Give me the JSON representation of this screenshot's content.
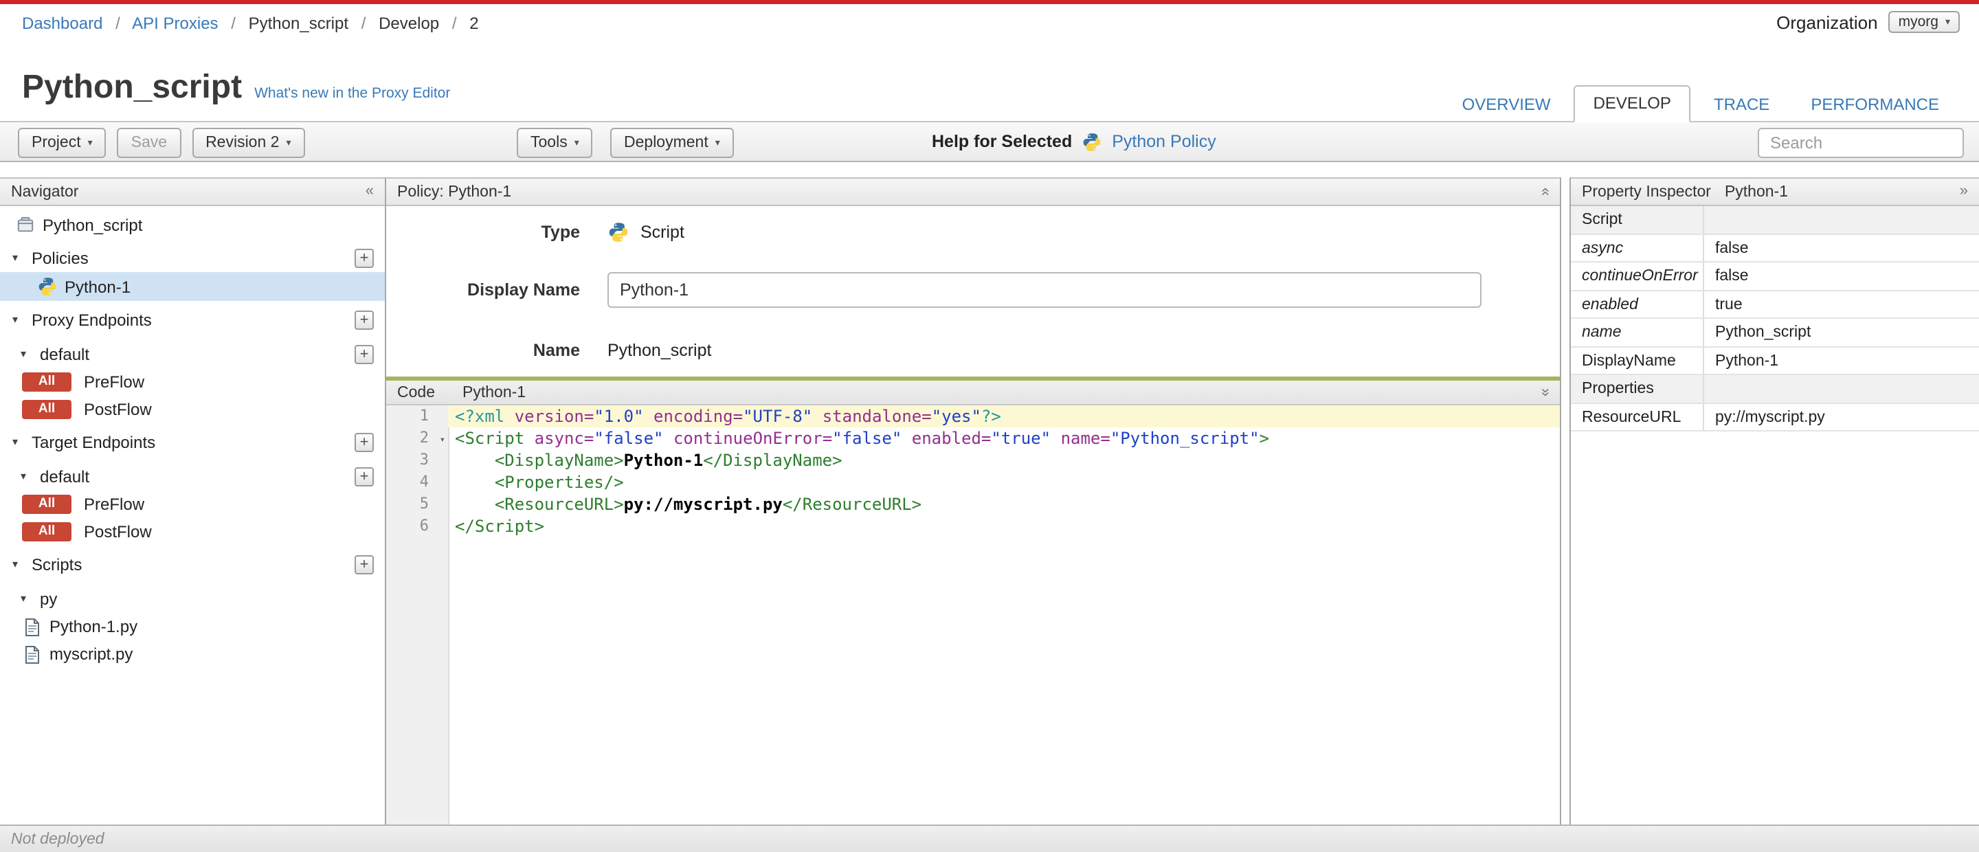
{
  "page": {
    "breadcrumb": {
      "separator": "/",
      "items": [
        {
          "label": "Dashboard",
          "link": true
        },
        {
          "label": "API Proxies",
          "link": true
        },
        {
          "label": "Python_script",
          "link": false
        },
        {
          "label": "Develop",
          "link": false
        },
        {
          "label": "2",
          "link": false
        }
      ]
    },
    "organization": {
      "label": "Organization",
      "value": "myorg"
    },
    "title": "Python_script",
    "whats_new": "What's new in the Proxy Editor",
    "tabs": [
      {
        "label": "OVERVIEW",
        "active": false
      },
      {
        "label": "DEVELOP",
        "active": true
      },
      {
        "label": "TRACE",
        "active": false
      },
      {
        "label": "PERFORMANCE",
        "active": false
      }
    ]
  },
  "toolbar": {
    "project": "Project",
    "save": "Save",
    "revision": "Revision 2",
    "tools": "Tools",
    "deployment": "Deployment",
    "help_for_selected": "Help for Selected",
    "help_link": "Python Policy",
    "search_placeholder": "Search"
  },
  "navigator": {
    "title": "Navigator",
    "collapse_icon": "«",
    "items": [
      {
        "type": "root",
        "label": "Python_script",
        "icon": "proxy-icon"
      },
      {
        "type": "section",
        "label": "Policies",
        "expanded": true,
        "plus": true
      },
      {
        "type": "policy",
        "label": "Python-1",
        "selected": true,
        "icon": "python-icon"
      },
      {
        "type": "section",
        "label": "Proxy Endpoints",
        "expanded": true,
        "plus": true
      },
      {
        "type": "subsection",
        "label": "default",
        "expanded": true,
        "plus": true
      },
      {
        "type": "flow",
        "badge": "All",
        "label": "PreFlow"
      },
      {
        "type": "flow",
        "badge": "All",
        "label": "PostFlow"
      },
      {
        "type": "section",
        "label": "Target Endpoints",
        "expanded": true,
        "plus": true
      },
      {
        "type": "subsection",
        "label": "default",
        "expanded": true,
        "plus": true
      },
      {
        "type": "flow",
        "badge": "All",
        "label": "PreFlow"
      },
      {
        "type": "flow",
        "badge": "All",
        "label": "PostFlow"
      },
      {
        "type": "section",
        "label": "Scripts",
        "expanded": true,
        "plus": true
      },
      {
        "type": "subsection",
        "label": "py",
        "expanded": true
      },
      {
        "type": "file",
        "label": "Python-1.py",
        "icon": "file-icon"
      },
      {
        "type": "file",
        "label": "myscript.py",
        "icon": "file-icon"
      }
    ]
  },
  "policy_panel": {
    "title": "Policy: Python-1",
    "type_label": "Type",
    "type_value": "Script",
    "type_icon": "python-icon",
    "display_name_label": "Display Name",
    "display_name_value": "Python-1",
    "name_label": "Name",
    "name_value": "Python_script"
  },
  "code": {
    "panel_label": "Code",
    "file_label": "Python-1",
    "lines": [
      {
        "n": 1,
        "highlight": true,
        "tokens": [
          [
            "meta",
            "<?xml"
          ],
          [
            "plain",
            " "
          ],
          [
            "attr",
            "version="
          ],
          [
            "str",
            "\"1.0\""
          ],
          [
            "plain",
            " "
          ],
          [
            "attr",
            "encoding="
          ],
          [
            "str",
            "\"UTF-8\""
          ],
          [
            "plain",
            " "
          ],
          [
            "attr",
            "standalone="
          ],
          [
            "str",
            "\"yes\""
          ],
          [
            "meta",
            "?>"
          ]
        ]
      },
      {
        "n": 2,
        "fold": true,
        "tokens": [
          [
            "tag",
            "<Script"
          ],
          [
            "plain",
            " "
          ],
          [
            "attr",
            "async="
          ],
          [
            "str",
            "\"false\""
          ],
          [
            "plain",
            " "
          ],
          [
            "attr",
            "continueOnError="
          ],
          [
            "str",
            "\"false\""
          ],
          [
            "plain",
            " "
          ],
          [
            "attr",
            "enabled="
          ],
          [
            "str",
            "\"true\""
          ],
          [
            "plain",
            " "
          ],
          [
            "attr",
            "name="
          ],
          [
            "str",
            "\"Python_script\""
          ],
          [
            "tag",
            ">"
          ]
        ]
      },
      {
        "n": 3,
        "tokens": [
          [
            "plain",
            "    "
          ],
          [
            "tag",
            "<DisplayName>"
          ],
          [
            "txt",
            "Python-1"
          ],
          [
            "tag",
            "</DisplayName>"
          ]
        ]
      },
      {
        "n": 4,
        "tokens": [
          [
            "plain",
            "    "
          ],
          [
            "tag",
            "<Properties/>"
          ]
        ]
      },
      {
        "n": 5,
        "tokens": [
          [
            "plain",
            "    "
          ],
          [
            "tag",
            "<ResourceURL>"
          ],
          [
            "txt",
            "py://myscript.py"
          ],
          [
            "tag",
            "</ResourceURL>"
          ]
        ]
      },
      {
        "n": 6,
        "tokens": [
          [
            "tag",
            "</Script>"
          ]
        ]
      }
    ]
  },
  "inspector": {
    "title": "Property Inspector",
    "subtitle": "Python-1",
    "expand_icon": "»",
    "rows": [
      {
        "name": "Script",
        "value": "",
        "section": true
      },
      {
        "name": "async",
        "value": "false",
        "italic": true
      },
      {
        "name": "continueOnError",
        "value": "false",
        "italic": true
      },
      {
        "name": "enabled",
        "value": "true",
        "italic": true
      },
      {
        "name": "name",
        "value": "Python_script",
        "italic": true
      },
      {
        "name": "DisplayName",
        "value": "Python-1"
      },
      {
        "name": "Properties",
        "value": "",
        "section": true
      },
      {
        "name": "ResourceURL",
        "value": "py://myscript.py"
      }
    ]
  },
  "statusbar": {
    "text": "Not deployed"
  },
  "colors": {
    "accent_red": "#d2232a",
    "link_blue": "#3879b8",
    "badge_red": "#c74634",
    "selected_row_blue": "#cfe2f4",
    "code_line_highlight": "#fcf8d3",
    "code_splitter_green": "#a3b55e"
  }
}
